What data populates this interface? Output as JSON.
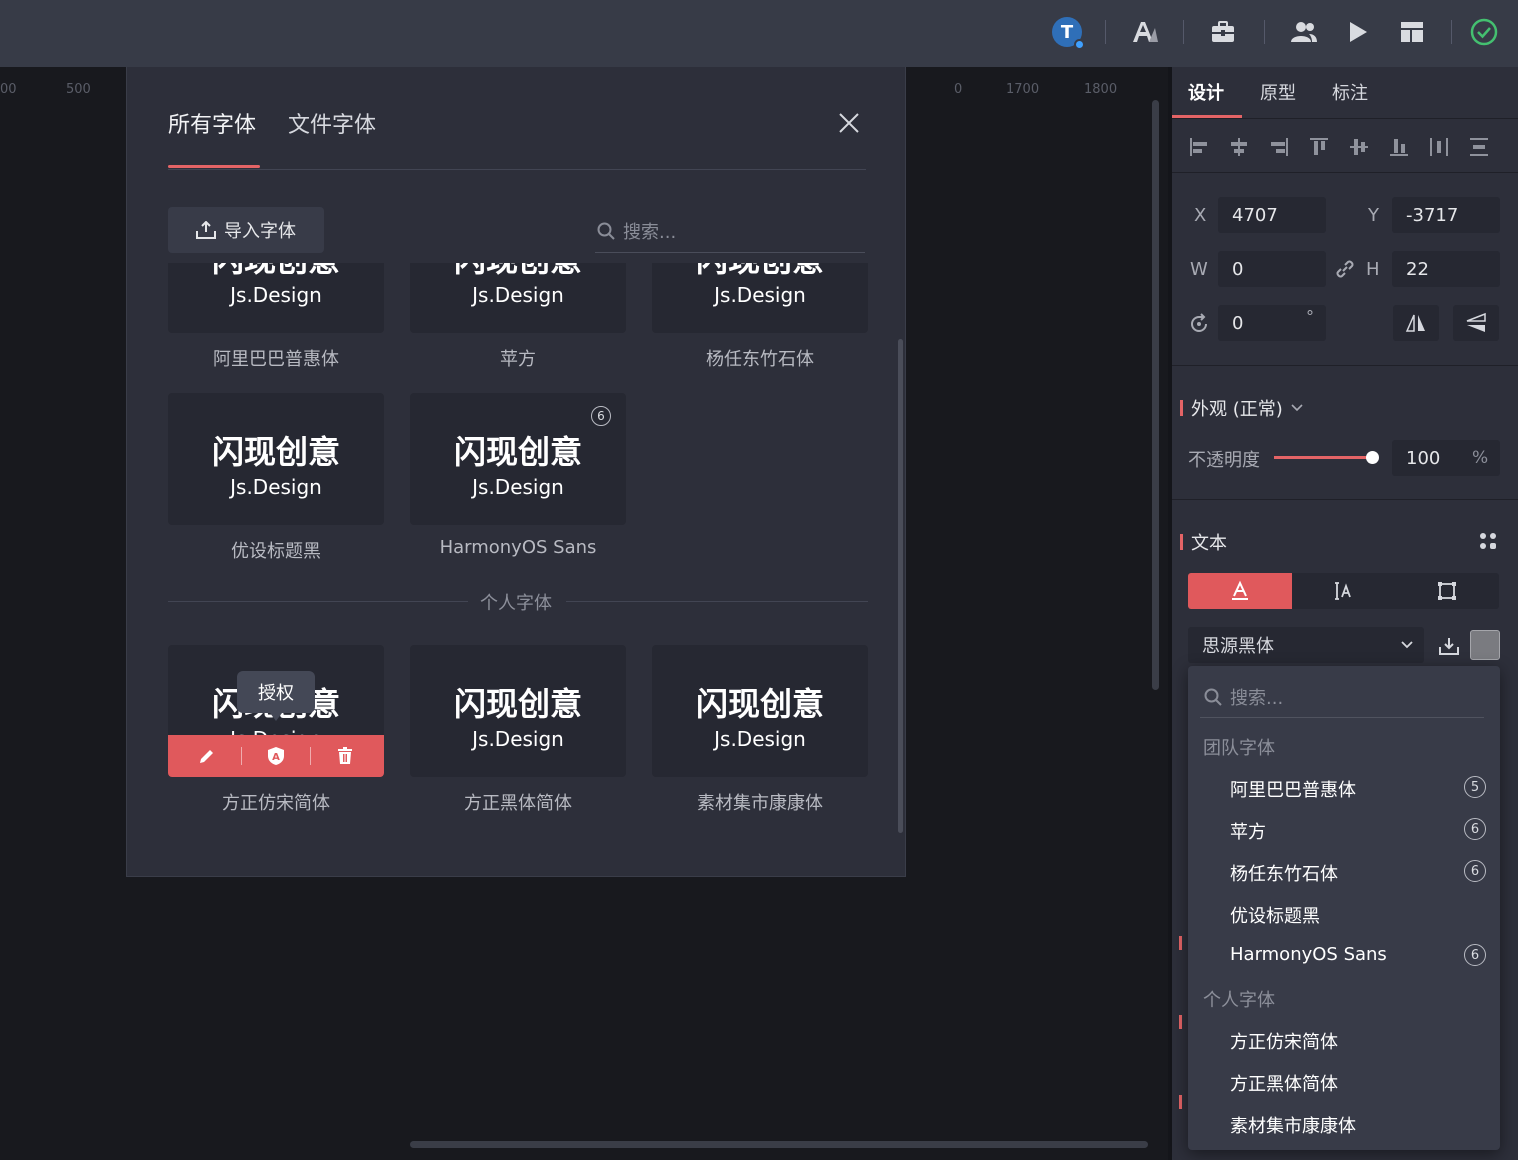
{
  "topbar": {
    "avatar_letter": "T",
    "colors": {
      "avatar": "#2f6fb8",
      "avatar_dot": "#3fa0ff",
      "ok": "#44c070"
    },
    "icons": [
      "avatar-icon",
      "font-icon",
      "toolbox-icon",
      "users-icon",
      "play-icon",
      "layout-icon",
      "check-circle-icon"
    ]
  },
  "ruler": {
    "labels": [
      "00",
      "500",
      "0",
      "1700",
      "1800"
    ]
  },
  "modal": {
    "tabs": [
      {
        "label": "所有字体"
      },
      {
        "label": "文件字体"
      }
    ],
    "import_label": "导入字体",
    "search_placeholder": "搜索...",
    "sample_title": "闪现创意",
    "sample_sub": "Js.Design",
    "top_row": [
      {
        "name": "阿里巴巴普惠体"
      },
      {
        "name": "苹方"
      },
      {
        "name": "杨任东竹石体"
      }
    ],
    "team_row": [
      {
        "name": "优设标题黑",
        "badge": ""
      },
      {
        "name": "HarmonyOS Sans",
        "badge": "6"
      }
    ],
    "personal_section_label": "个人字体",
    "personal_row": [
      {
        "name": "方正仿宋简体"
      },
      {
        "name": "方正黑体简体"
      },
      {
        "name": "素材集市康康体"
      }
    ],
    "tooltip": "授权",
    "sample_sub_clipped": "Js.Design"
  },
  "panel": {
    "tabs": [
      {
        "label": "设计"
      },
      {
        "label": "原型"
      },
      {
        "label": "标注"
      }
    ],
    "x_label": "X",
    "x_value": "4707",
    "y_label": "Y",
    "y_value": "-3717",
    "w_label": "W",
    "w_value": "0",
    "h_label": "H",
    "h_value": "22",
    "rotation_value": "0",
    "degree": "°",
    "appearance_title": "外观 (正常)",
    "opacity_label": "不透明度",
    "opacity_value": "100",
    "opacity_unit": "%",
    "opacity_level": 100,
    "text_title": "文本",
    "font_value": "思源黑体"
  },
  "dropdown": {
    "search_placeholder": "搜索...",
    "team_group": "团队字体",
    "team_items": [
      {
        "name": "阿里巴巴普惠体",
        "badge": "5"
      },
      {
        "name": "苹方",
        "badge": "6"
      },
      {
        "name": "杨任东竹石体",
        "badge": "6"
      },
      {
        "name": "优设标题黑",
        "badge": ""
      },
      {
        "name": "HarmonyOS Sans",
        "badge": "6"
      }
    ],
    "personal_group": "个人字体",
    "personal_items": [
      {
        "name": "方正仿宋简体"
      },
      {
        "name": "方正黑体简体"
      },
      {
        "name": "素材集市康康体"
      }
    ]
  }
}
